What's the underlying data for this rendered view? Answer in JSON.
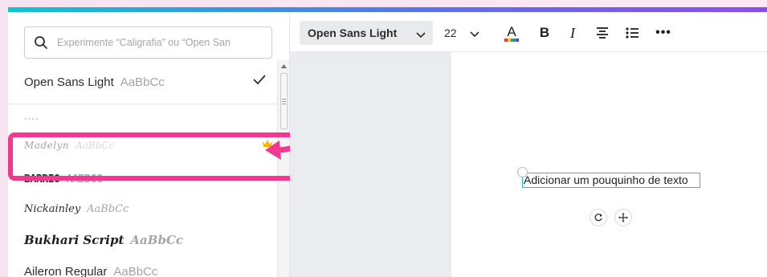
{
  "search": {
    "placeholder": "Experimente “Caligrafia” ou “Open San"
  },
  "fonts": {
    "selected": {
      "name": "Open Sans Light",
      "sample": "AaBbCc"
    },
    "partial": {
      "name": "...."
    },
    "list": [
      {
        "name": "Madelyn",
        "sample": "AaBbCc",
        "premium": true
      },
      {
        "name": "BARRIO",
        "sample": "AABBCC"
      },
      {
        "name": "Nickainley",
        "sample": "AaBbCc"
      },
      {
        "name": "Bukhari Script",
        "sample": "AaBbCc"
      },
      {
        "name": "Aileron Regular",
        "sample": "AaBbCc"
      }
    ]
  },
  "toolbar": {
    "font_name": "Open Sans Light",
    "font_size": "22",
    "bold_label": "B",
    "italic_label": "I",
    "more_label": "•••"
  },
  "canvas": {
    "text": "Adicionar um pouquinho de texto"
  },
  "colors": {
    "accent_gradient_start": "#13c3cf",
    "accent_gradient_end": "#8b4ee6",
    "highlight": "#f2388f",
    "selection": "#14c3d6",
    "premium_crown": "#f4b400"
  },
  "icons": {
    "search": "search-icon",
    "check": "check-icon",
    "crown": "crown-icon",
    "chevron": "chevron-down-icon",
    "text_color": "text-color-icon",
    "align": "align-center-icon",
    "list": "list-icon",
    "rotate": "rotate-icon",
    "move": "move-icon"
  }
}
